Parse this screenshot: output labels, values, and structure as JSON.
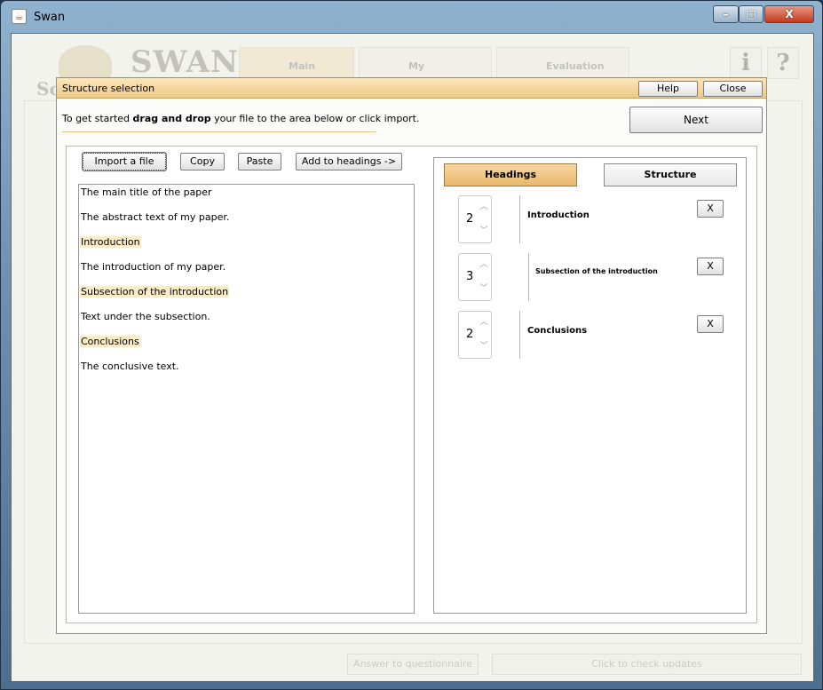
{
  "window": {
    "title": "Swan",
    "icon": "java-cup-icon",
    "minimize": "–",
    "maximize": "□",
    "close": "X"
  },
  "background_app": {
    "brand": "SWAN",
    "brand_fragment": "Sc",
    "tabs": [
      "Main",
      "My",
      "Evaluation"
    ],
    "info_button": "i",
    "help_button": "?",
    "questionnaire_button": "Answer to questionnaire",
    "updates_button": "Click to check updates"
  },
  "dialog": {
    "title": "Structure selection",
    "help_label": "Help",
    "close_label": "Close",
    "intro_prefix": "To get started ",
    "intro_bold": "drag and drop",
    "intro_suffix": " your file to the area below or click import.",
    "next_label": "Next"
  },
  "toolbar": {
    "import_label": "Import a file",
    "copy_label": "Copy",
    "paste_label": "Paste",
    "add_label": "Add to headings ->"
  },
  "document_lines": [
    {
      "text": "The main title of the paper",
      "highlighted": false
    },
    {
      "text": "The abstract text of my paper.",
      "highlighted": false
    },
    {
      "text": "Introduction",
      "highlighted": true
    },
    {
      "text": "The introduction of my paper.",
      "highlighted": false
    },
    {
      "text": "Subsection of the introduction",
      "highlighted": true
    },
    {
      "text": "Text under the subsection.",
      "highlighted": false
    },
    {
      "text": "Conclusions",
      "highlighted": true
    },
    {
      "text": "The conclusive text.",
      "highlighted": false
    }
  ],
  "panel": {
    "headings_tab": "Headings",
    "structure_tab": "Structure",
    "headings": [
      {
        "level": "2",
        "title": "Introduction",
        "remove_label": "X"
      },
      {
        "level": "3",
        "title": "Subsection of the introduction",
        "remove_label": "X"
      },
      {
        "level": "2",
        "title": "Conclusions",
        "remove_label": "X"
      }
    ]
  },
  "colors": {
    "accent": "#efc985",
    "highlight": "#fbecc8",
    "separator": "#d9b36d"
  }
}
